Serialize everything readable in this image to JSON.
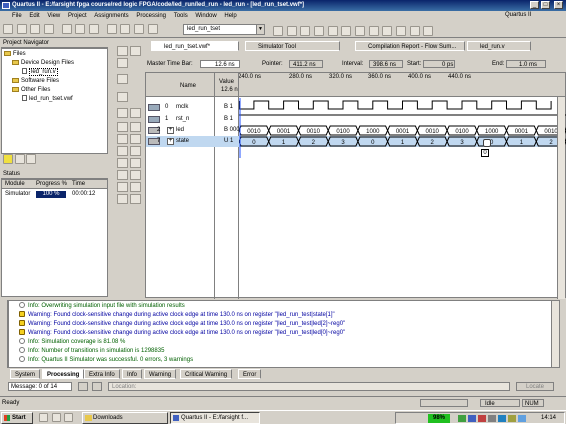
{
  "window": {
    "title": "Quartus II - E:/farsight fpga course/red logic FPGA/code/led_run/led_run - led_run - [led_run_tset.vwf*]",
    "brand": "Quartus II"
  },
  "menu": [
    "File",
    "Edit",
    "View",
    "Project",
    "Assignments",
    "Processing",
    "Tools",
    "Window",
    "Help"
  ],
  "toolbar": {
    "project_combo": "led_run_tset"
  },
  "navigator": {
    "title": "Project Navigator",
    "tree": [
      {
        "label": "Files",
        "level": 0
      },
      {
        "label": "Device Design Files",
        "level": 1
      },
      {
        "label": "led_run.v",
        "level": 2
      },
      {
        "label": "Software Files",
        "level": 1
      },
      {
        "label": "Other Files",
        "level": 1
      },
      {
        "label": "led_run_tset.vwf",
        "level": 2
      }
    ]
  },
  "status_panel": {
    "title": "Status",
    "headers": [
      "Module",
      "Progress %",
      "Time"
    ],
    "row": {
      "module": "Simulator",
      "progress": "100 %",
      "time": "00:00:12"
    }
  },
  "doc_tabs": [
    "led_run_tset.vwf*",
    "Simulator Tool",
    "Compilation Report - Flow Sum...",
    "led_run.v"
  ],
  "timebar": {
    "master_label": "Master Time Bar:",
    "master_value": "12.6 ns",
    "pointer_label": "Pointer:",
    "pointer_value": "411.2 ns",
    "interval_label": "Interval:",
    "interval_value": "398.6 ns",
    "start_label": "Start:",
    "start_value": "0 ps",
    "end_label": "End:",
    "end_value": "1.0 ms"
  },
  "waveform": {
    "name_header": "Name",
    "value_header": "Value",
    "value_sub": "12.6 n",
    "time_ticks": [
      "240.0 ns",
      "280.0 ns",
      "320.0 ns",
      "360.0 ns",
      "400.0 ns",
      "440.0 ns"
    ],
    "signals": [
      {
        "index": "0",
        "name": "mclk",
        "value": "B 1"
      },
      {
        "index": "1",
        "name": "rst_n",
        "value": "B 1"
      },
      {
        "index": "2",
        "name": "led",
        "value": "B 000"
      },
      {
        "index": "7",
        "name": "state",
        "value": "U 1"
      }
    ],
    "led_bus": [
      "0010",
      "0001",
      "0010",
      "0100",
      "1000",
      "0001",
      "0010",
      "0100",
      "1000",
      "0001",
      "0010"
    ],
    "state_bus": [
      "0",
      "1",
      "2",
      "3",
      "0",
      "1",
      "2",
      "3",
      "0",
      "1",
      "2"
    ],
    "cursor_tip": "0"
  },
  "messages": [
    {
      "kind": "info",
      "text": "Info: Overwriting simulation input file with simulation results"
    },
    {
      "kind": "warn",
      "text": "Warning: Found clock-sensitive change during active clock edge at time 130.0 ns on register \"|led_run_test|state[1]\""
    },
    {
      "kind": "warn",
      "text": "Warning: Found clock-sensitive change during active clock edge at time 130.0 ns on register \"|led_run_test|led[2]~reg0\""
    },
    {
      "kind": "warn",
      "text": "Warning: Found clock-sensitive change during active clock edge at time 130.0 ns on register \"|led_run_test|led[0]~reg0\""
    },
    {
      "kind": "info",
      "text": "Info: Simulation coverage is      81.08 %"
    },
    {
      "kind": "info",
      "text": "Info: Number of transitions in simulation is 1298835"
    },
    {
      "kind": "info",
      "text": "Info: Quartus II Simulator was successful. 0 errors, 3 warnings"
    }
  ],
  "message_tabs": [
    "System",
    "Processing",
    "Extra Info",
    "Info",
    "Warning",
    "Critical Warning",
    "Error"
  ],
  "message_footer": {
    "count": "Message: 0 of 14",
    "location_placeholder": "Location:",
    "locate": "Locate"
  },
  "status_bar": {
    "left": "Ready",
    "mode": "Idle",
    "num": "NUM"
  },
  "taskbar": {
    "start": "Start",
    "items": [
      "Downloads",
      "Quartus II - E:/farsight f..."
    ],
    "battery": "98%",
    "clock": "14:14"
  },
  "colors": {
    "accent": "#0a246a",
    "selection": "#c0d8f0",
    "warn": "#f4d020"
  }
}
